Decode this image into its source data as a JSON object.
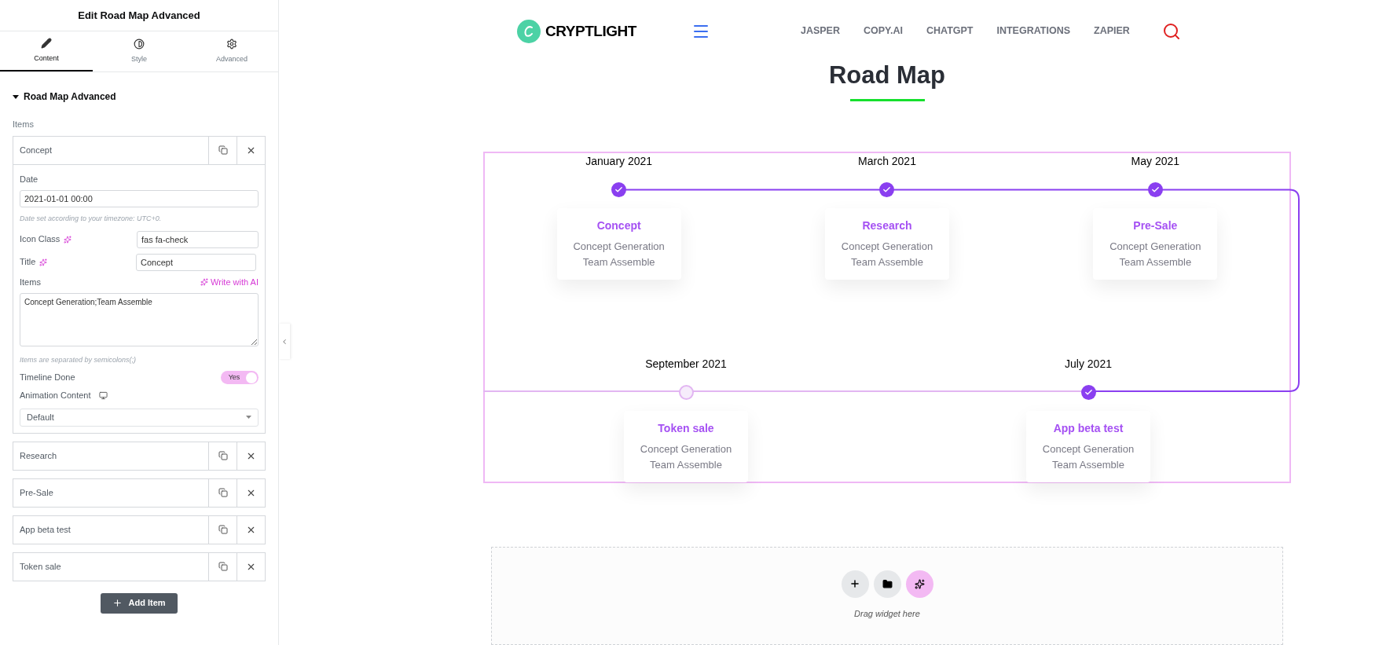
{
  "editor": {
    "title": "Edit Road Map Advanced",
    "tabs": [
      {
        "label": "Content",
        "selected": true
      },
      {
        "label": "Style",
        "selected": false
      },
      {
        "label": "Advanced",
        "selected": false
      }
    ],
    "section": {
      "title": "Road Map Advanced",
      "expanded": true
    },
    "items_label": "Items",
    "repeater": [
      {
        "title": "Concept",
        "expanded": true
      },
      {
        "title": "Research",
        "expanded": false
      },
      {
        "title": "Pre-Sale",
        "expanded": false
      },
      {
        "title": "App beta test",
        "expanded": false
      },
      {
        "title": "Token sale",
        "expanded": false
      }
    ],
    "form": {
      "date_label": "Date",
      "date_value": "2021-01-01 00:00",
      "date_note": "Date set according to your timezone: UTC+0.",
      "icon_class_label": "Icon Class",
      "icon_class_value": "fas fa-check",
      "title_label": "Title",
      "title_value": "Concept",
      "items_label": "Items",
      "write_ai": "Write with AI",
      "items_value": "Concept Generation;Team Assemble",
      "items_note": "Items are separated by semicolons(;)",
      "timeline_done_label": "Timeline Done",
      "timeline_done": {
        "on": true,
        "label": "Yes"
      },
      "animation_label": "Animation Content",
      "animation_value": "Default"
    },
    "add_button": "Add Item"
  },
  "site": {
    "logo": "CRYPTLIGHT",
    "nav": [
      "JASPER",
      "COPY.AI",
      "CHATGPT",
      "INTEGRATIONS",
      "ZAPIER"
    ],
    "heading": "Road Map",
    "timeline": [
      [
        {
          "date": "January 2021",
          "title": "Concept",
          "lines": [
            "Concept Generation",
            "Team Assemble"
          ],
          "done": true
        },
        {
          "date": "March 2021",
          "title": "Research",
          "lines": [
            "Concept Generation",
            "Team Assemble"
          ],
          "done": true
        },
        {
          "date": "May 2021",
          "title": "Pre-Sale",
          "lines": [
            "Concept Generation",
            "Team Assemble"
          ],
          "done": true
        }
      ],
      [
        {
          "date": "September 2021",
          "title": "Token sale",
          "lines": [
            "Concept Generation",
            "Team Assemble"
          ],
          "done": false
        },
        {
          "date": "July 2021",
          "title": "App beta test",
          "lines": [
            "Concept Generation",
            "Team Assemble"
          ],
          "done": true
        }
      ]
    ],
    "dropzone_hint": "Drag widget here"
  }
}
